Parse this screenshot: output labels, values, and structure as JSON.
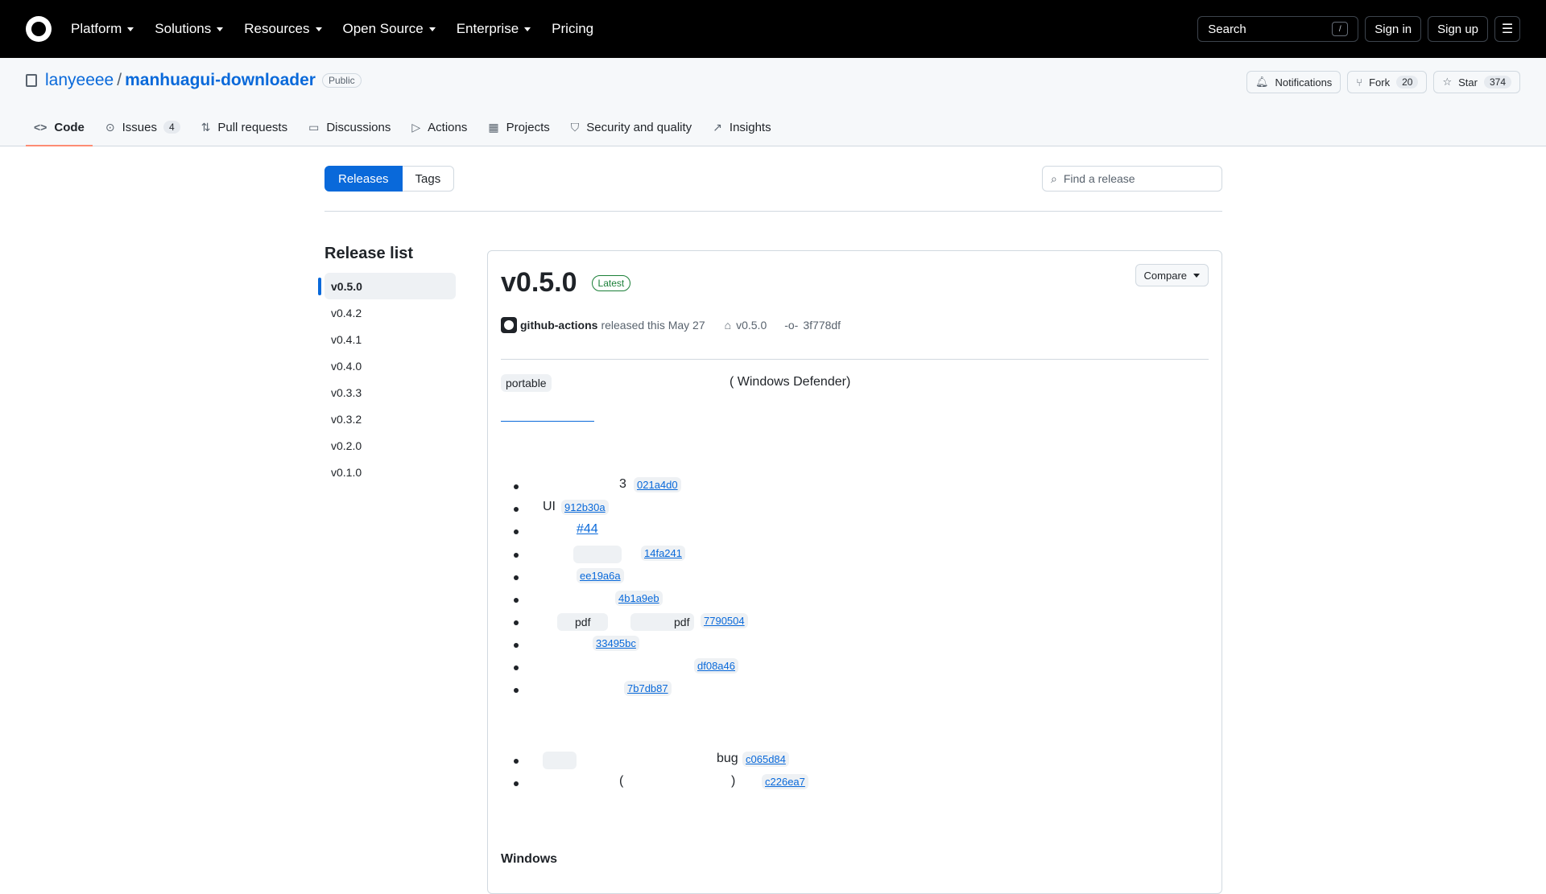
{
  "header": {
    "nav": [
      "Platform",
      "Solutions",
      "Resources",
      "Open Source",
      "Enterprise",
      "Pricing"
    ],
    "search_label": "Search",
    "search_shortcut": "/",
    "sign_in": "Sign in",
    "sign_up": "Sign up"
  },
  "repo": {
    "owner": "lanyeeee",
    "separator": "/",
    "name": "manhuagui-downloader",
    "visibility": "Public",
    "notifications": "Notifications",
    "fork_label": "Fork",
    "fork_count": "20",
    "star_label": "Star",
    "star_count": "374"
  },
  "tabs": [
    {
      "label": "Code",
      "icon": "code-icon"
    },
    {
      "label": "Issues",
      "count": "4",
      "icon": "issue-icon"
    },
    {
      "label": "Pull requests",
      "icon": "pull-request-icon"
    },
    {
      "label": "Discussions",
      "icon": "discussions-icon"
    },
    {
      "label": "Actions",
      "icon": "play-icon"
    },
    {
      "label": "Projects",
      "icon": "table-icon"
    },
    {
      "label": "Security and quality",
      "icon": "shield-icon"
    },
    {
      "label": "Insights",
      "icon": "graph-icon"
    }
  ],
  "subnav": {
    "releases": "Releases",
    "tags": "Tags",
    "find_placeholder": "Find a release"
  },
  "sidebar": {
    "title": "Release list",
    "items": [
      "v0.5.0",
      "v0.4.2",
      "v0.4.1",
      "v0.4.0",
      "v0.3.3",
      "v0.3.2",
      "v0.2.0",
      "v0.1.0"
    ]
  },
  "release": {
    "compare": "Compare",
    "version": "v0.5.0",
    "badge": "Latest",
    "author": "github-actions",
    "released_text": "released this May 27",
    "tag": "v0.5.0",
    "commit": "3f778df",
    "intro_code": "portable",
    "intro_text": "(  Windows Defender)",
    "features": {
      "f1_text": "3",
      "f1_hash": "021a4d0",
      "f2_text": "UI",
      "f2_hash": "912b30a",
      "f3_issue": "#44",
      "f4_hash": "14fa241",
      "f5_hash": "ee19a6a",
      "f6_hash": "4b1a9eb",
      "f7_code1": "pdf",
      "f7_code2": "pdf",
      "f7_hash": "7790504",
      "f8_hash": "33495bc",
      "f9_hash": "df08a46",
      "f10_hash": "7b7db87"
    },
    "fixes": {
      "x1_text": "bug",
      "x1_hash": "c065d84",
      "x2_open": "(",
      "x2_close": ")",
      "x2_hash": "c226ea7"
    },
    "section_windows": "Windows"
  }
}
